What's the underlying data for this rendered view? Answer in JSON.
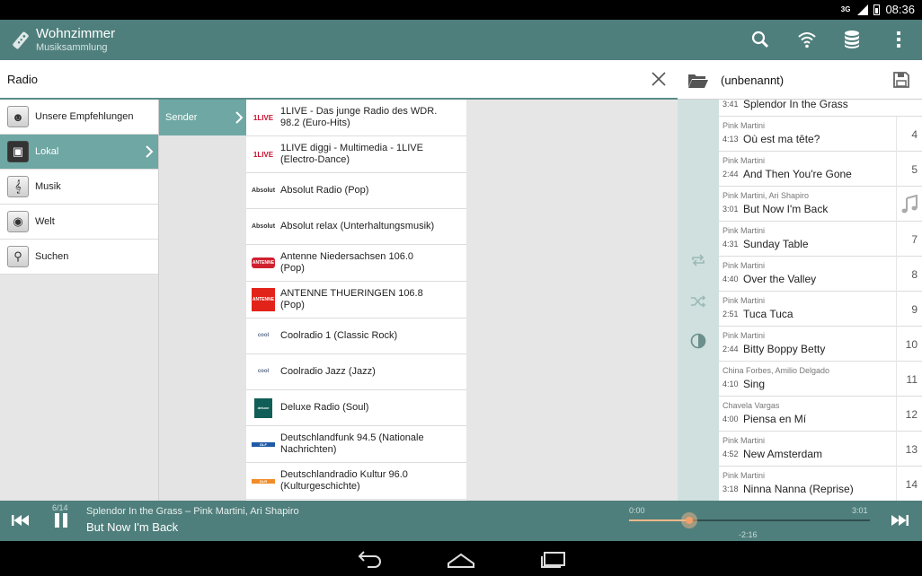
{
  "status_bar": {
    "network": "3G",
    "time": "08:36"
  },
  "action_bar": {
    "title": "Wohnzimmer",
    "subtitle": "Musiksammlung",
    "icons": [
      "remote-icon",
      "search-icon",
      "wifi-icon",
      "database-icon",
      "overflow-menu-icon"
    ]
  },
  "search": {
    "value": "Radio"
  },
  "categories": [
    {
      "label": "Unsere Empfehlungen",
      "icon": "people-icon"
    },
    {
      "label": "Lokal",
      "icon": "local-icon",
      "selected": true
    },
    {
      "label": "Musik",
      "icon": "music-clef-icon"
    },
    {
      "label": "Welt",
      "icon": "globe-icon"
    },
    {
      "label": "Suchen",
      "icon": "magnifier-icon"
    }
  ],
  "subcategory": {
    "label": "Sender"
  },
  "stations": [
    {
      "line1": "1LIVE - Das junge Radio des WDR.",
      "line2": "98.2 (Euro-Hits)",
      "logo_text": "1LIVE",
      "logo_color": "#c8102e"
    },
    {
      "line1": "1LIVE diggi - Multimedia - 1LIVE",
      "line2": "(Electro-Dance)",
      "logo_text": "1LIVE",
      "logo_color": "#c8102e"
    },
    {
      "line1": "Absolut Radio (Pop)",
      "line2": "",
      "logo_text": "Absolut",
      "logo_color": "#333333"
    },
    {
      "line1": "Absolut relax (Unterhaltungsmusik)",
      "line2": "",
      "logo_text": "Absolut",
      "logo_color": "#333333"
    },
    {
      "line1": "Antenne Niedersachsen 106.0",
      "line2": "(Pop)",
      "logo_text": "ANTENNE",
      "logo_color": "#d0202e"
    },
    {
      "line1": "ANTENNE THUERINGEN 106.8",
      "line2": "(Pop)",
      "logo_text": "ANTENNE",
      "logo_color": "#e2231a"
    },
    {
      "line1": "Coolradio 1 (Classic Rock)",
      "line2": "",
      "logo_text": "cool",
      "logo_color": "#5a6a8a"
    },
    {
      "line1": "Coolradio Jazz (Jazz)",
      "line2": "",
      "logo_text": "cool",
      "logo_color": "#5a6a8a"
    },
    {
      "line1": "Deluxe Radio (Soul)",
      "line2": "",
      "logo_text": "deluxe",
      "logo_color": "#0f5e57"
    },
    {
      "line1": "Deutschlandfunk 94.5 (Nationale",
      "line2": "Nachrichten)",
      "logo_text": "DLF",
      "logo_color": "#1f5aa6"
    },
    {
      "line1": "Deutschlandradio Kultur 96.0",
      "line2": "(Kulturgeschichte)",
      "logo_text": "DLR",
      "logo_color": "#f28c28"
    }
  ],
  "playlist": {
    "title": "(unbenannt)",
    "partial_track": {
      "duration": "3:41",
      "title": "Splendor In the Grass"
    },
    "tracks": [
      {
        "artist": "Pink Martini",
        "duration": "4:13",
        "title": "Où est ma tête?",
        "number": "4"
      },
      {
        "artist": "Pink Martini",
        "duration": "2:44",
        "title": "And Then You're Gone",
        "number": "5"
      },
      {
        "artist": "Pink Martini, Ari Shapiro",
        "duration": "3:01",
        "title": "But Now I'm Back",
        "number": "",
        "playing": true
      },
      {
        "artist": "Pink Martini",
        "duration": "4:31",
        "title": "Sunday Table",
        "number": "7"
      },
      {
        "artist": "Pink Martini",
        "duration": "4:40",
        "title": "Over the Valley",
        "number": "8"
      },
      {
        "artist": "Pink Martini",
        "duration": "2:51",
        "title": "Tuca Tuca",
        "number": "9"
      },
      {
        "artist": "Pink Martini",
        "duration": "2:44",
        "title": "Bitty Boppy Betty",
        "number": "10"
      },
      {
        "artist": "China Forbes, Amilio Delgado",
        "duration": "4:10",
        "title": "Sing",
        "number": "11"
      },
      {
        "artist": "Chavela Vargas",
        "duration": "4:00",
        "title": "Piensa en Mí",
        "number": "12"
      },
      {
        "artist": "Pink Martini",
        "duration": "4:52",
        "title": "New Amsterdam",
        "number": "13"
      },
      {
        "artist": "Pink Martini",
        "duration": "3:18",
        "title": "Ninna Nanna (Reprise)",
        "number": "14"
      }
    ]
  },
  "player": {
    "position": "6/14",
    "line1": "Splendor In the Grass – Pink Martini, Ari Shapiro",
    "line2": "But Now I'm Back",
    "time_elapsed": "0:00",
    "time_total": "3:01",
    "time_remaining": "-2:16",
    "progress": 0.25
  },
  "colors": {
    "accent": "#4f7f7c",
    "selected": "#6ea7a3",
    "side": "#cfe0df",
    "seek": "#f3a06a"
  }
}
